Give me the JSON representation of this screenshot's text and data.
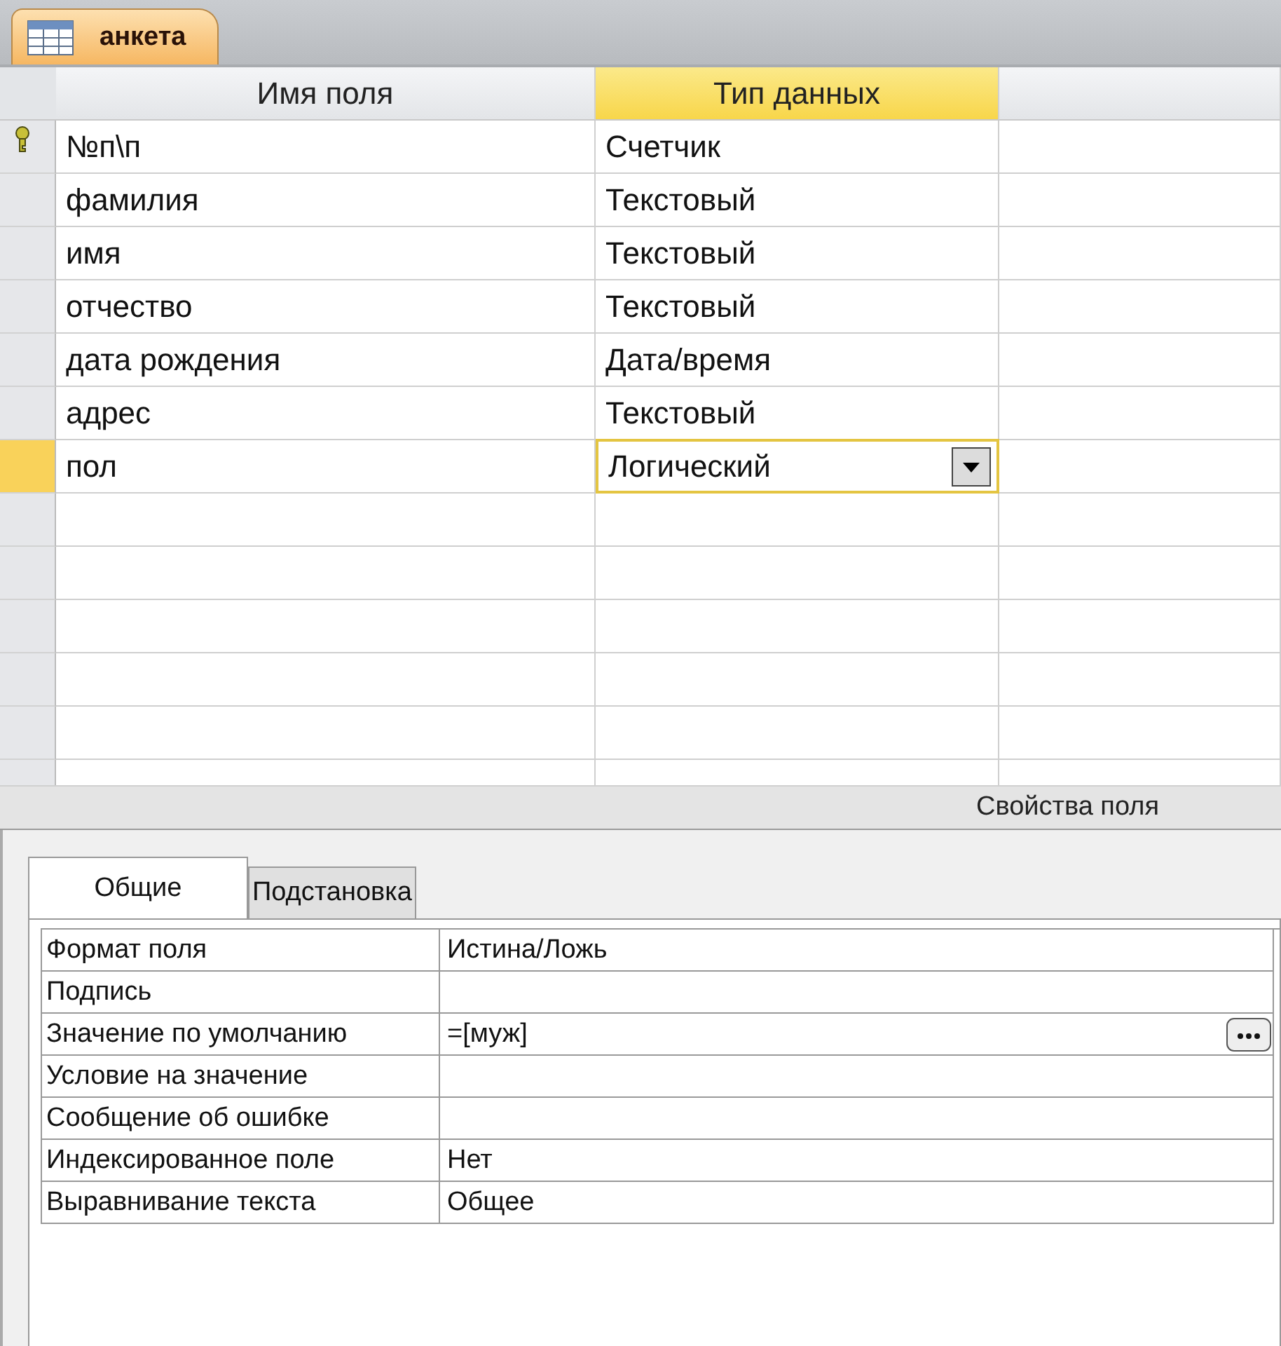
{
  "document_tab": {
    "title": "анкета",
    "selected": true
  },
  "grid": {
    "columns": [
      {
        "label": "Имя поля",
        "selected": false
      },
      {
        "label": "Тип данных",
        "selected": true
      }
    ],
    "rows": [
      {
        "name": "№п\\п",
        "type": "Счетчик",
        "primary_key": true,
        "selected": false,
        "editing": false
      },
      {
        "name": "фамилия",
        "type": "Текстовый",
        "primary_key": false,
        "selected": false,
        "editing": false
      },
      {
        "name": "имя",
        "type": "Текстовый",
        "primary_key": false,
        "selected": false,
        "editing": false
      },
      {
        "name": "отчество",
        "type": "Текстовый",
        "primary_key": false,
        "selected": false,
        "editing": false
      },
      {
        "name": "дата рождения",
        "type": "Дата/время",
        "primary_key": false,
        "selected": false,
        "editing": false
      },
      {
        "name": "адрес",
        "type": "Текстовый",
        "primary_key": false,
        "selected": false,
        "editing": false
      },
      {
        "name": "пол",
        "type": "Логический",
        "primary_key": false,
        "selected": true,
        "editing": true
      }
    ]
  },
  "properties_title": "Свойства поля",
  "property_tabs": [
    {
      "label": "Общие",
      "selected": true
    },
    {
      "label": "Подстановка",
      "selected": false
    }
  ],
  "properties": [
    {
      "label": "Формат поля",
      "value": "Истина/Ложь",
      "builder": false
    },
    {
      "label": "Подпись",
      "builder": false
    },
    {
      "label": "Значение по умолчанию",
      "value": "=[муж]",
      "builder": true
    },
    {
      "label": "Условие на значение",
      "builder": false
    },
    {
      "label": "Сообщение об ошибке",
      "builder": false
    },
    {
      "label": "Индексированное поле",
      "value": "Нет",
      "builder": false
    },
    {
      "label": "Выравнивание текста",
      "value": "Общее",
      "builder": false
    }
  ]
}
